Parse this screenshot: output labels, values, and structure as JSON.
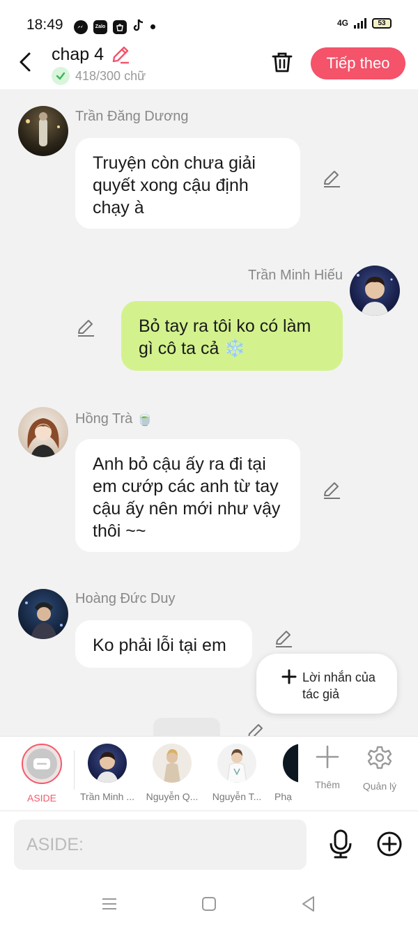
{
  "status": {
    "time": "18:49",
    "apps": [
      "messenger-icon",
      "Zalo",
      "shopee-icon",
      "tiktok-icon"
    ],
    "network": "4G",
    "battery": "53"
  },
  "header": {
    "title": "chap 4",
    "word_count": "418/300 chữ",
    "next_label": "Tiếp theo"
  },
  "messages": [
    {
      "sender": "Trần Đăng Dương",
      "text": "Truyện còn chưa giải quyết xong cậu định chạy à",
      "side": "left"
    },
    {
      "sender": "Trần Minh Hiếu",
      "text": "Bỏ tay ra tôi ko có làm gì cô ta cả ❄️",
      "side": "right"
    },
    {
      "sender": "Hồng Trà 🍵",
      "text": "Anh bỏ cậu ấy ra đi tại em cướp các anh từ tay cậu ấy nên mới như vậy thôi ~~",
      "side": "left"
    },
    {
      "sender": "Hoàng Đức Duy",
      "text": "Ko phải lỗi tại em",
      "side": "left"
    }
  ],
  "author_note": {
    "label": "Lời nhắn của tác giả"
  },
  "characters": {
    "aside": "ASIDE",
    "list": [
      "Trần Minh ...",
      "Nguyễn Q...",
      "Nguyễn T...",
      "Phạ"
    ],
    "add": "Thêm",
    "manage": "Quản lý"
  },
  "input": {
    "placeholder": "ASIDE:"
  },
  "colors": {
    "accent": "#f4536a",
    "mine_bubble": "#d3f28d",
    "check": "#3cb55a"
  }
}
